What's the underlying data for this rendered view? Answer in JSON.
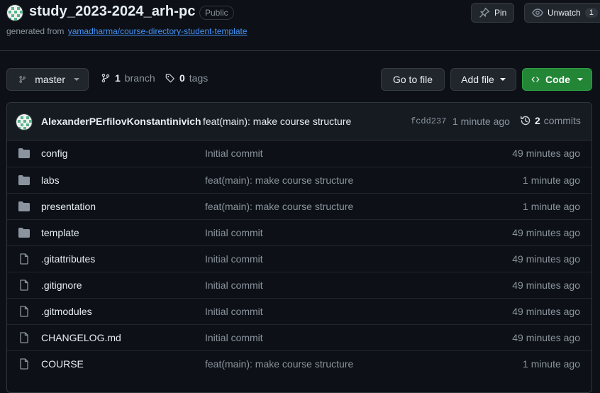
{
  "repo": {
    "title": "study_2023-2024_arh-pc",
    "visibility": "Public",
    "generated_prefix": "generated from",
    "template_link": "yamadharma/course-directory-student-template"
  },
  "header_actions": {
    "pin_label": "Pin",
    "unwatch_label": "Unwatch",
    "watch_count": "1"
  },
  "toolbar": {
    "branch_selector": "master",
    "branch_count": "1",
    "branch_word": "branch",
    "tag_count": "0",
    "tag_word": "tags",
    "go_to_file": "Go to file",
    "add_file": "Add file",
    "code": "Code"
  },
  "latest_commit": {
    "author": "AlexanderPErfilovKonstantinivich",
    "message": "feat(main): make course structure",
    "sha": "fcdd237",
    "age": "1 minute ago",
    "commit_count": "2",
    "commit_word": "commits"
  },
  "files": [
    {
      "type": "dir",
      "name": "config",
      "message": "Initial commit",
      "age": "49 minutes ago"
    },
    {
      "type": "dir",
      "name": "labs",
      "message": "feat(main): make course structure",
      "age": "1 minute ago"
    },
    {
      "type": "dir",
      "name": "presentation",
      "message": "feat(main): make course structure",
      "age": "1 minute ago"
    },
    {
      "type": "dir",
      "name": "template",
      "message": "Initial commit",
      "age": "49 minutes ago"
    },
    {
      "type": "file",
      "name": ".gitattributes",
      "message": "Initial commit",
      "age": "49 minutes ago"
    },
    {
      "type": "file",
      "name": ".gitignore",
      "message": "Initial commit",
      "age": "49 minutes ago"
    },
    {
      "type": "file",
      "name": ".gitmodules",
      "message": "Initial commit",
      "age": "49 minutes ago"
    },
    {
      "type": "file",
      "name": "CHANGELOG.md",
      "message": "Initial commit",
      "age": "49 minutes ago"
    },
    {
      "type": "file",
      "name": "COURSE",
      "message": "feat(main): make course structure",
      "age": "1 minute ago"
    }
  ],
  "colors": {
    "background": "#0d1117",
    "link": "#4493f8",
    "code_button": "#238636",
    "folder_icon": "#8b949e"
  }
}
